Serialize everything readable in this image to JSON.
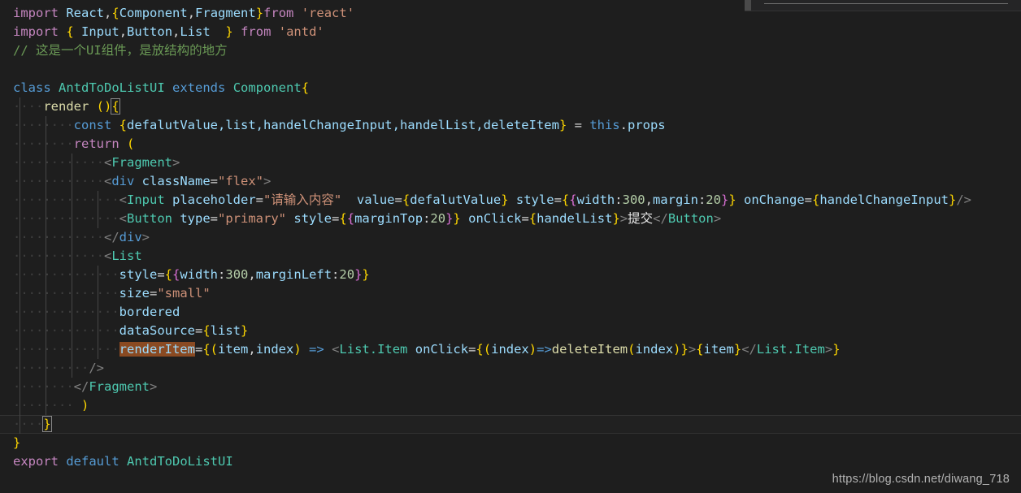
{
  "editor": {
    "background_color": "#1e1e1e",
    "active_line_background": "#212121",
    "indent_guide_color": "#464646",
    "selection_highlight_color": "#8a4a22",
    "language": "javascript-jsx",
    "theme": "Dark+ (default dark)",
    "selected_word": "renderItem",
    "active_line_number": 22
  },
  "palette": {
    "keyword_control": "#c586c0",
    "keyword_declaration": "#569cd6",
    "identifier": "#9cdcfe",
    "type": "#4ec9b0",
    "string": "#ce9178",
    "number": "#b5cea8",
    "function": "#dcdcaa",
    "comment": "#6a9955",
    "punctuation": "#808080",
    "text": "#d4d4d4",
    "brace_level1": "#ffd700",
    "brace_level2": "#da70d6",
    "brace_level3": "#179fff"
  },
  "code_lines": [
    "import React,{Component,Fragment}from 'react'",
    "import { Input,Button,List  } from 'antd'",
    "// 这是一个UI组件，是放结构的地方",
    "",
    "class AntdToDoListUI extends Component{",
    "    render (){",
    "        const {defalutValue,list,handelChangeInput,handelList,deleteItem} = this.props",
    "        return (",
    "            <Fragment>",
    "            <div className=\"flex\">",
    "              <Input placeholder=\"请输入内容\"  value={defalutValue} style={{width:300,margin:20}} onChange={handelChangeInput}/>",
    "              <Button type=\"primary\" style={{marginTop:20}} onClick={handelList}>提交</Button>",
    "            </div>",
    "            <List",
    "              style={{width:300,marginLeft:20}}",
    "              size=\"small\"",
    "              bordered",
    "              dataSource={list}",
    "              renderItem={(item,index) => <List.Item onClick={(index)=>deleteItem(index)}>{item}</List.Item>}",
    "            />",
    "            </Fragment>",
    "          )",
    "    }",
    "}",
    "export default AntdToDoListUI"
  ],
  "tokens": {
    "import": "import",
    "from": "from",
    "export": "export",
    "default": "default",
    "class": "class",
    "extends": "extends",
    "const": "const",
    "return": "return",
    "this": "this",
    "props": "props",
    "react_module": "'react'",
    "antd_module": "'antd'",
    "react_ident": "React",
    "component_type": "Component",
    "fragment_type": "Fragment",
    "input_type": "Input",
    "button_type": "Button",
    "list_type": "List",
    "class_name": "AntdToDoListUI",
    "render_method": "render",
    "comment_text": "// 这是一个UI组件，是放结构的地方",
    "destructured": "defalutValue,list,handelChangeInput,handelList,deleteItem",
    "div_tag": "div",
    "classname_attr": "className",
    "flex_value": "\"flex\"",
    "placeholder_attr": "placeholder",
    "placeholder_value": "\"请输入内容\"",
    "value_attr": "value",
    "style_attr": "style",
    "onchange_attr": "onChange",
    "onclick_attr": "onClick",
    "type_attr": "type",
    "primary_value": "\"primary\"",
    "size_attr": "size",
    "small_value": "\"small\"",
    "bordered_attr": "bordered",
    "datasource_attr": "dataSource",
    "renderitem_attr": "renderItem",
    "submit_text": "提交",
    "width_key": "width",
    "margin_key": "margin",
    "margintop_key": "marginTop",
    "marginleft_key": "marginLeft",
    "num_300": "300",
    "num_20": "20",
    "item_var": "item",
    "index_var": "index",
    "list_var": "list",
    "defalut_value_var": "defalutValue",
    "handel_change_input_var": "handelChangeInput",
    "handel_list_var": "handelList",
    "delete_item_fn": "deleteItem",
    "list_item_tag": "List.Item",
    "arrow": "=>"
  },
  "watermark": {
    "url": "https://blog.csdn.net/diwang_718"
  },
  "top_strip": {
    "name": "horizontal-scrollbar-sliver"
  }
}
